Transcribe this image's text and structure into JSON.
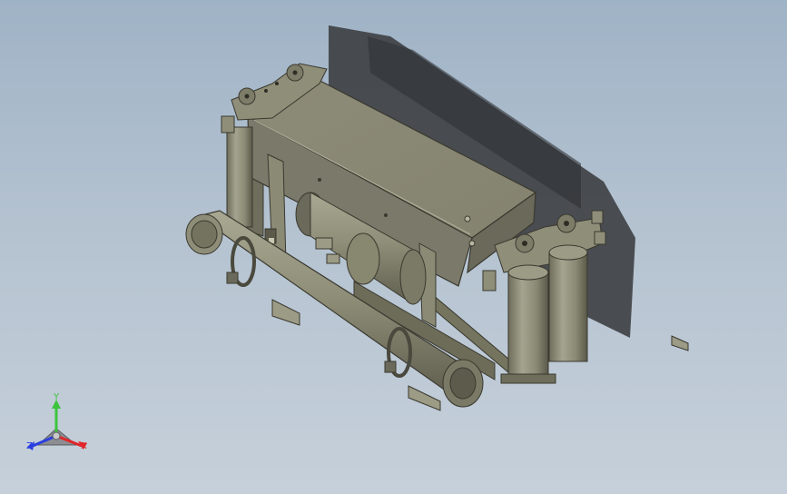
{
  "viewport": {
    "background_top": "#9fb3c6",
    "background_bottom": "#c6d0da",
    "model_color": "#8e8d78",
    "shadow_color": "#3b3d40"
  },
  "triad": {
    "x_label": "X",
    "y_label": "Y",
    "z_label": "Z",
    "x_color": "#e0262b",
    "y_color": "#3cc43c",
    "z_color": "#2b3fe0"
  }
}
